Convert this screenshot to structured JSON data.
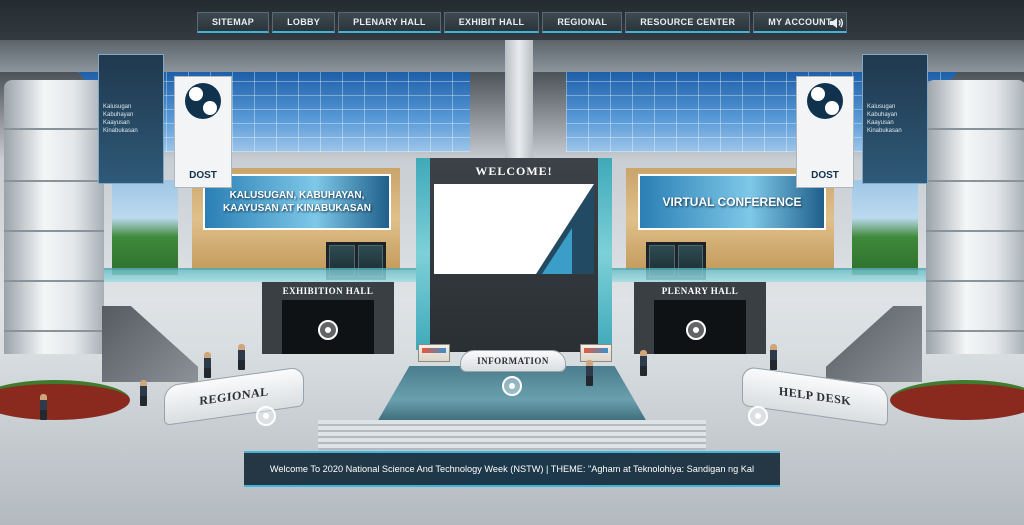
{
  "nav": {
    "items": [
      {
        "label": "SITEMAP"
      },
      {
        "label": "LOBBY"
      },
      {
        "label": "PLENARY HALL"
      },
      {
        "label": "EXHIBIT HALL"
      },
      {
        "label": "REGIONAL"
      },
      {
        "label": "RESOURCE CENTER"
      },
      {
        "label": "MY ACCOUNT"
      }
    ],
    "speaker_icon": "speaker-icon"
  },
  "center_screen": {
    "title": "WELCOME!"
  },
  "wall_banners": {
    "left": "KALUSUGAN, KABUHAYAN, KAAYUSAN AT KINABUKASAN",
    "right": "VIRTUAL CONFERENCE"
  },
  "dost_banners": {
    "tagline": [
      "Kalusugan",
      "Kabuhayan",
      "Kaayusan",
      "Kinabukasan"
    ],
    "logo_text": "DOST"
  },
  "halls": {
    "exhibition": "EXHIBITION HALL",
    "plenary": "PLENARY HALL"
  },
  "desks": {
    "information": "INFORMATION",
    "regional": "REGIONAL",
    "help_desk": "HELP DESK"
  },
  "ticker": {
    "text": "Welcome To 2020 National Science And Technology Week (NSTW) | THEME: \"Agham at Teknolohiya: Sandigan ng Kal"
  },
  "colors": {
    "accent": "#3fb4d8",
    "nav_bg": "#2b343a",
    "banner_blue": "#2a7fb4"
  }
}
